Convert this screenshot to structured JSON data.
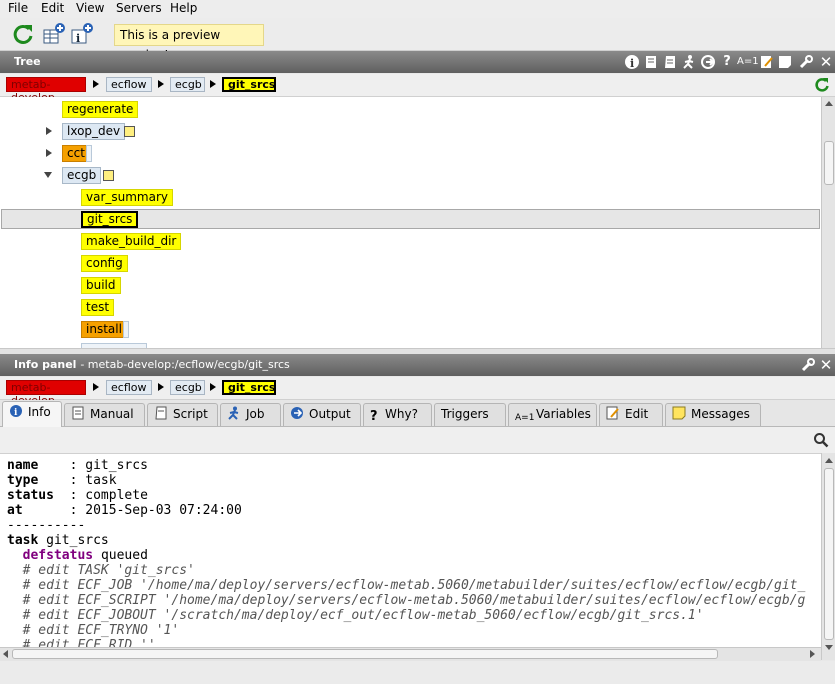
{
  "menubar": {
    "items": [
      "File",
      "Edit",
      "View",
      "Servers",
      "Help"
    ]
  },
  "toolbar": {
    "preview_label": "This is a preview version!",
    "buttons": [
      "refresh-icon",
      "add-table-view-icon",
      "add-info-view-icon"
    ]
  },
  "tree_panel": {
    "title": "Tree",
    "breadcrumb": [
      "metab-develop",
      "ecflow",
      "ecgb",
      "git_srcs"
    ],
    "nodes": [
      {
        "label": "regenerate",
        "status": "complete"
      },
      {
        "label": "lxop_dev",
        "status": "unknown"
      },
      {
        "label": "cct",
        "status": "active"
      },
      {
        "label": "ecgb",
        "status": "unknown"
      },
      {
        "label": "var_summary",
        "status": "complete"
      },
      {
        "label": "git_srcs",
        "status": "complete"
      },
      {
        "label": "make_build_dir",
        "status": "complete"
      },
      {
        "label": "config",
        "status": "complete"
      },
      {
        "label": "build",
        "status": "complete"
      },
      {
        "label": "test",
        "status": "complete"
      },
      {
        "label": "install",
        "status": "active"
      }
    ]
  },
  "info_panel": {
    "title": "Info panel",
    "path": "- metab-develop:/ecflow/ecgb/git_srcs",
    "breadcrumb": [
      "metab-develop",
      "ecflow",
      "ecgb",
      "git_srcs"
    ],
    "tabs": [
      "Info",
      "Manual",
      "Script",
      "Job",
      "Output",
      "Why?",
      "Triggers",
      "Variables",
      "Edit",
      "Messages"
    ],
    "active_tab": "Info",
    "fields": [
      {
        "key": "name",
        "value": "git_srcs"
      },
      {
        "key": "type",
        "value": "task"
      },
      {
        "key": "status",
        "value": "complete"
      },
      {
        "key": "at",
        "value": "2015-Sep-03 07:24:00"
      }
    ],
    "separator": "----------",
    "definition": {
      "task_kw": "task",
      "task_name": "git_srcs",
      "defstatus_kw": "defstatus",
      "defstatus_value": "queued",
      "comments": [
        "# edit TASK 'git_srcs'",
        "# edit ECF_JOB '/home/ma/deploy/servers/ecflow-metab.5060/metabuilder/suites/ecflow/ecflow/ecgb/git_",
        "# edit ECF_SCRIPT '/home/ma/deploy/servers/ecflow-metab.5060/metabuilder/suites/ecflow/ecflow/ecgb/g",
        "# edit ECF_JOBOUT '/scratch/ma/deploy/ecf_out/ecflow-metab_5060/ecflow/ecgb/git_srcs.1'",
        "# edit ECF_TRYNO '1'",
        "# edit ECF_RID ''"
      ]
    }
  },
  "colors": {
    "complete": "#ffff00",
    "active": "#f5a000",
    "unknown": "#dde8f3",
    "server_red": "#e00000",
    "titlebar": "#6e6e6e",
    "preview_bg": "#fff6b8"
  }
}
